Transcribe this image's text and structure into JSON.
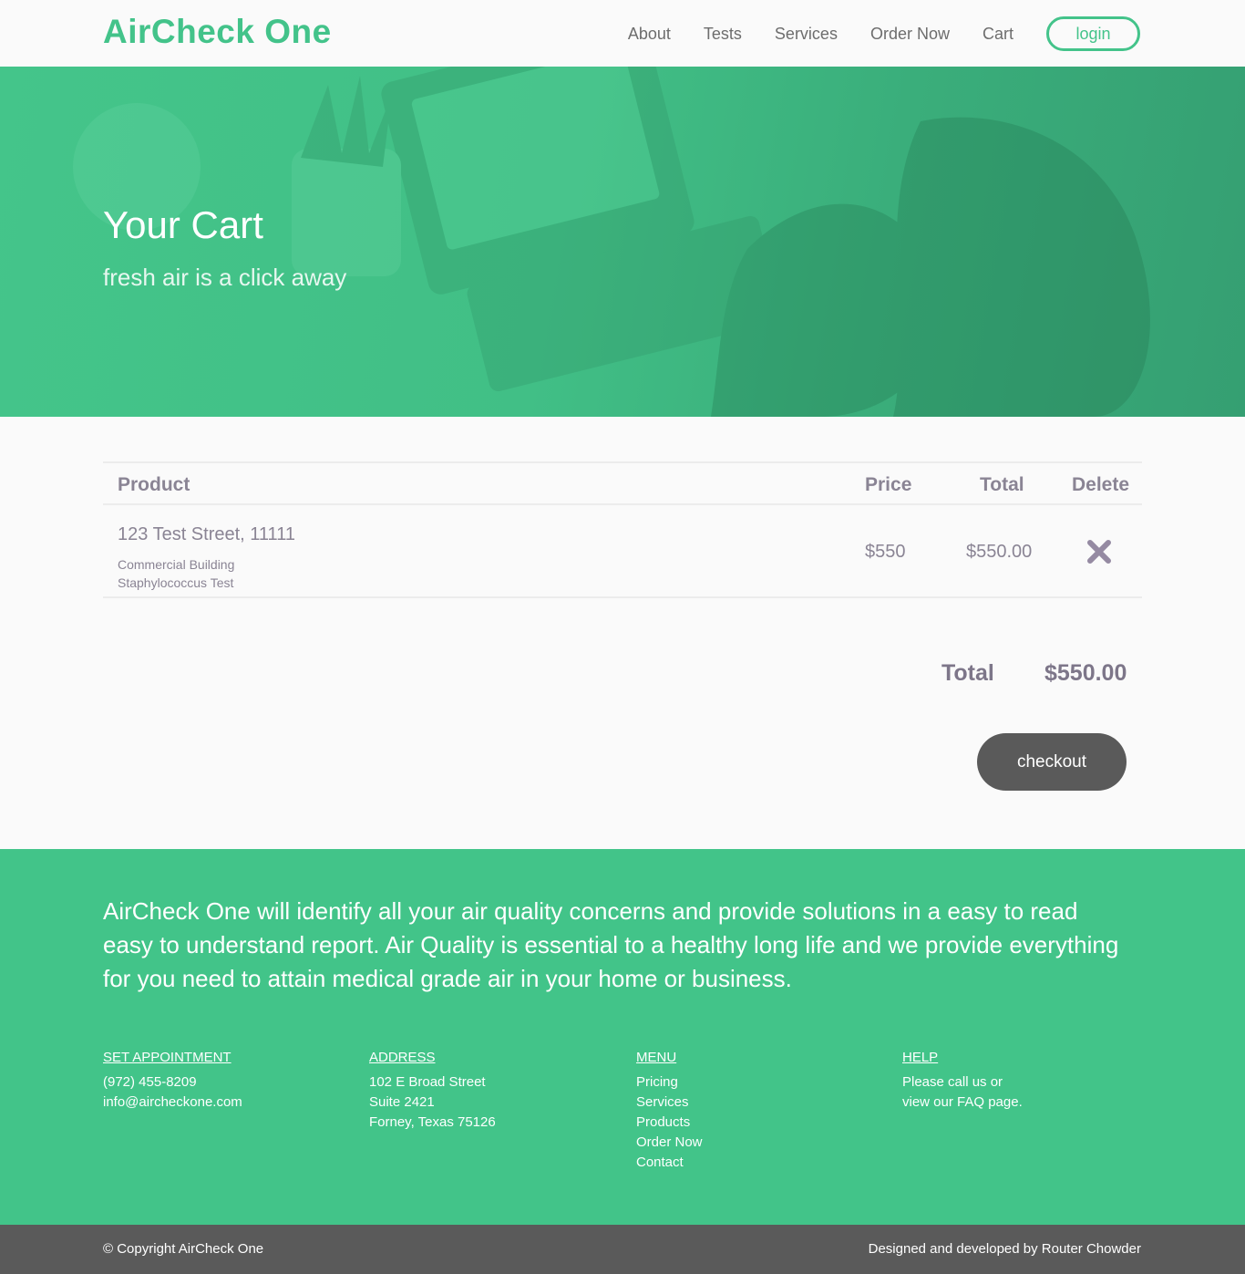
{
  "header": {
    "brand": "AirCheck One",
    "nav": [
      "About",
      "Tests",
      "Services",
      "Order Now",
      "Cart"
    ],
    "login": "login"
  },
  "hero": {
    "title": "Your Cart",
    "subtitle": "fresh air is a click away"
  },
  "cart": {
    "columns": {
      "product": "Product",
      "price": "Price",
      "total": "Total",
      "delete": "Delete"
    },
    "items": [
      {
        "name": "123 Test Street, 11111",
        "building": "Commercial Building",
        "test": "Staphylococcus Test",
        "price": "$550",
        "total": "$550.00"
      }
    ],
    "total_label": "Total",
    "total_value": "$550.00",
    "checkout": "checkout"
  },
  "footer": {
    "about": "AirCheck One will identify all your air quality concerns and provide solutions in a easy to read easy to understand report. Air Quality is essential to a healthy long life and we provide everything for you need to attain medical grade air in your home or business.",
    "appointment": {
      "heading": "SET APPOINTMENT",
      "lines": [
        "(972) 455-8209",
        "info@aircheckone.com"
      ]
    },
    "address": {
      "heading": "ADDRESS",
      "lines": [
        "102 E Broad Street",
        "Suite 2421",
        "Forney, Texas 75126"
      ]
    },
    "menu": {
      "heading": "MENU",
      "lines": [
        "Pricing",
        "Services",
        "Products",
        "Order Now",
        "Contact"
      ]
    },
    "help": {
      "heading": "HELP",
      "lines": [
        "Please call us or",
        "view our FAQ page."
      ]
    },
    "copyright": "© Copyright AirCheck One",
    "credit": "Designed and developed by Router Chowder"
  },
  "colors": {
    "brand": "#43c38a",
    "footer": "#42c489",
    "dark": "#5a5a5a",
    "text": "#8a8494"
  },
  "icons": {
    "delete": "close-icon"
  }
}
